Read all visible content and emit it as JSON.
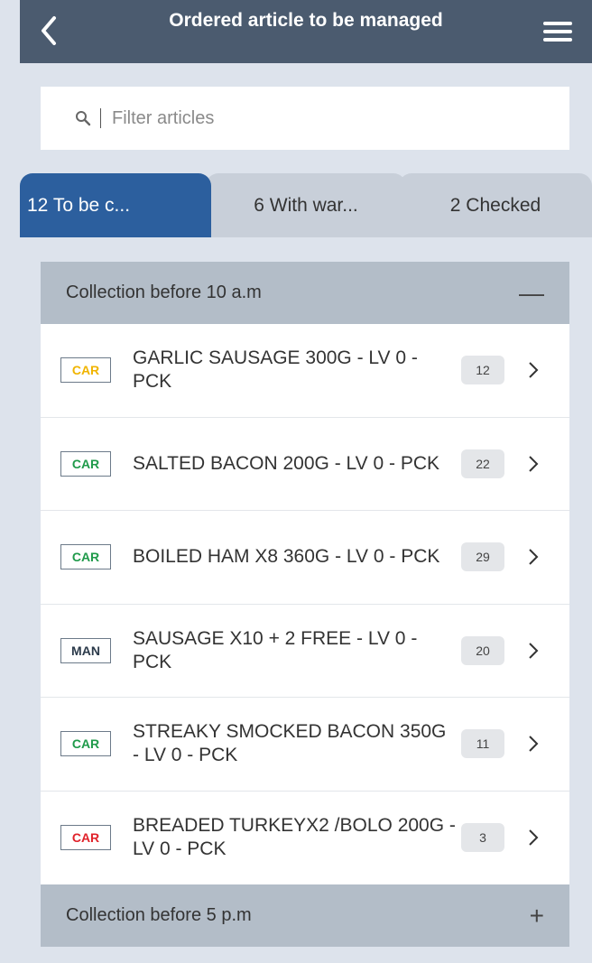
{
  "header": {
    "title": "Ordered article to be managed",
    "back_icon": "chevron-left-icon",
    "menu_icon": "hamburger-menu-icon"
  },
  "search": {
    "placeholder": "Filter articles",
    "icon": "search-icon"
  },
  "tabs": [
    {
      "label": "12 To be c...",
      "active": true
    },
    {
      "label": "6 With war...",
      "active": false
    },
    {
      "label": "2 Checked",
      "active": false
    }
  ],
  "sections": [
    {
      "title": "Collection before 10 a.m",
      "toggle": "—",
      "expanded": true,
      "items": [
        {
          "tag": "CAR",
          "tag_color": "#f0b400",
          "name": "GARLIC SAUSAGE 300G - LV 0 - PCK",
          "count": "12"
        },
        {
          "tag": "CAR",
          "tag_color": "#1f9a4a",
          "name": "SALTED BACON 200G - LV 0 - PCK",
          "count": "22"
        },
        {
          "tag": "CAR",
          "tag_color": "#1f9a4a",
          "name": "BOILED HAM X8 360G - LV 0 - PCK",
          "count": "29"
        },
        {
          "tag": "MAN",
          "tag_color": "#2b3a4a",
          "name": "SAUSAGE X10 + 2 FREE - LV 0 - PCK",
          "count": "20"
        },
        {
          "tag": "CAR",
          "tag_color": "#1f9a4a",
          "name": "STREAKY SMOCKED BACON 350G - LV 0 - PCK",
          "count": "11"
        },
        {
          "tag": "CAR",
          "tag_color": "#e0222a",
          "name": "BREADED TURKEYX2 /BOLO 200G - LV 0 - PCK",
          "count": "3"
        }
      ]
    },
    {
      "title": "Collection before 5 p.m",
      "toggle": "+",
      "expanded": false
    }
  ],
  "colors": {
    "header_bg": "#4b5b6f",
    "active_tab": "#2c5f9e",
    "section_bg": "#b3bdc8",
    "page_bg": "#dde3ec"
  }
}
